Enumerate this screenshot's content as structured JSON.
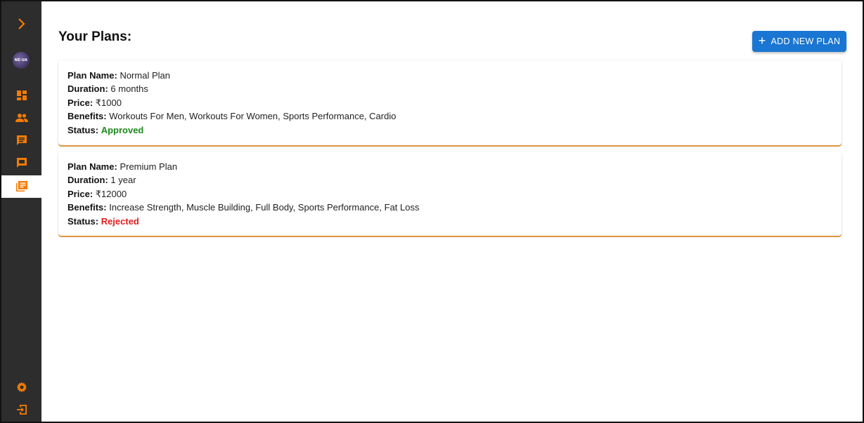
{
  "sidebar": {
    "avatar_text": "NE-UA",
    "items": [
      {
        "name": "expand",
        "icon": "chevron-right-icon"
      },
      {
        "name": "dashboard",
        "icon": "dashboard-icon"
      },
      {
        "name": "clients",
        "icon": "people-icon"
      },
      {
        "name": "messages",
        "icon": "chat-icon"
      },
      {
        "name": "feedback",
        "icon": "feedback-icon"
      },
      {
        "name": "plans",
        "icon": "library-books-icon",
        "active": true
      },
      {
        "name": "settings",
        "icon": "gear-icon"
      },
      {
        "name": "logout",
        "icon": "logout-icon"
      }
    ],
    "accent_color": "#f57c00"
  },
  "header": {
    "title": "Your Plans:",
    "add_button_label": "ADD NEW PLAN",
    "add_button_icon": "+"
  },
  "labels": {
    "plan_name": "Plan Name:",
    "duration": "Duration:",
    "price": "Price:",
    "benefits": "Benefits:",
    "status": "Status:"
  },
  "plans": [
    {
      "name": "Normal Plan",
      "duration": "6 months",
      "price": "₹1000",
      "benefits": "Workouts For Men, Workouts For Women, Sports Performance, Cardio",
      "status": "Approved",
      "status_color": "#1b8a1b"
    },
    {
      "name": "Premium Plan",
      "duration": "1 year",
      "price": "₹12000",
      "benefits": "Increase Strength, Muscle Building, Full Body, Sports Performance, Fat Loss",
      "status": "Rejected",
      "status_color": "#e11d1d"
    }
  ]
}
